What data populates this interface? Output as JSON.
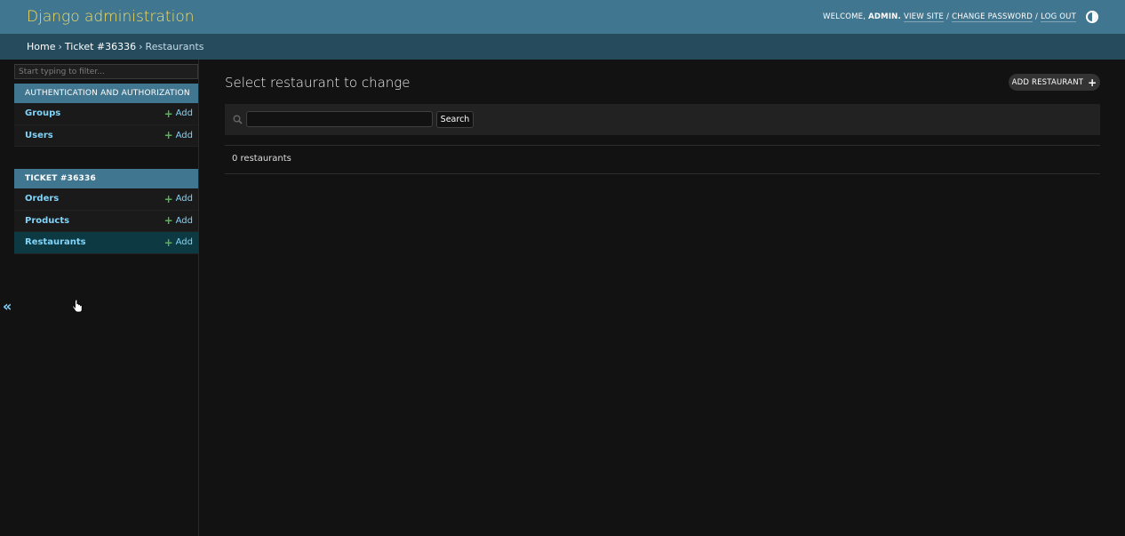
{
  "header": {
    "branding": "Django administration",
    "welcome": "WELCOME,",
    "user": "ADMIN.",
    "view_site": "VIEW SITE",
    "change_password": "CHANGE PASSWORD",
    "log_out": "LOG OUT",
    "separator": "/"
  },
  "breadcrumbs": {
    "home": "Home",
    "app": "Ticket #36336",
    "current": "Restaurants",
    "arrow": "›"
  },
  "sidebar": {
    "filter_placeholder": "Start typing to filter...",
    "collapse_glyph": "«",
    "modules": [
      {
        "caption": "AUTHENTICATION AND AUTHORIZATION",
        "models": [
          {
            "name": "Groups",
            "add": "Add"
          },
          {
            "name": "Users",
            "add": "Add"
          }
        ]
      },
      {
        "caption": "TICKET #36336",
        "models": [
          {
            "name": "Orders",
            "add": "Add"
          },
          {
            "name": "Products",
            "add": "Add"
          },
          {
            "name": "Restaurants",
            "add": "Add"
          }
        ]
      }
    ]
  },
  "content": {
    "title": "Select restaurant to change",
    "add_button": "ADD RESTAURANT",
    "search_button": "Search",
    "search_value": "",
    "result_count": "0 restaurants"
  },
  "colors": {
    "header_bg": "#417690",
    "breadcrumbs_bg": "#264b5d",
    "branding": "#f5dd5d",
    "link": "#81d4fa",
    "selected_row": "#0d3a42",
    "page_bg": "#121212"
  }
}
